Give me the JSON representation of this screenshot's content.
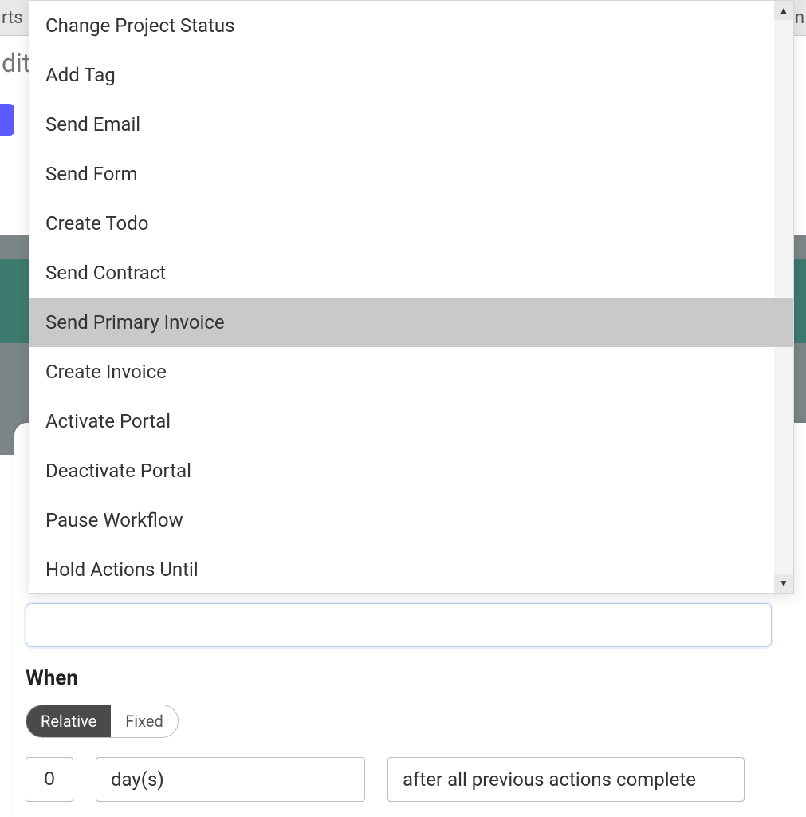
{
  "bg": {
    "top_left_fragment": "rts",
    "top_right_fragment": "n",
    "edit_fragment": "dit"
  },
  "dropdown": {
    "items": [
      {
        "label": "Change Project Status",
        "highlight": false
      },
      {
        "label": "Add Tag",
        "highlight": false
      },
      {
        "label": "Send Email",
        "highlight": false
      },
      {
        "label": "Send Form",
        "highlight": false
      },
      {
        "label": "Create Todo",
        "highlight": false
      },
      {
        "label": "Send Contract",
        "highlight": false
      },
      {
        "label": "Send Primary Invoice",
        "highlight": true
      },
      {
        "label": "Create Invoice",
        "highlight": false
      },
      {
        "label": "Activate Portal",
        "highlight": false
      },
      {
        "label": "Deactivate Portal",
        "highlight": false
      },
      {
        "label": "Pause Workflow",
        "highlight": false
      },
      {
        "label": "Hold Actions Until",
        "highlight": false
      }
    ]
  },
  "when": {
    "label": "When",
    "toggle": {
      "active": "Relative",
      "inactive": "Fixed"
    },
    "number_value": "0",
    "unit_value": "day(s)",
    "relative_value": "after all previous actions complete"
  }
}
